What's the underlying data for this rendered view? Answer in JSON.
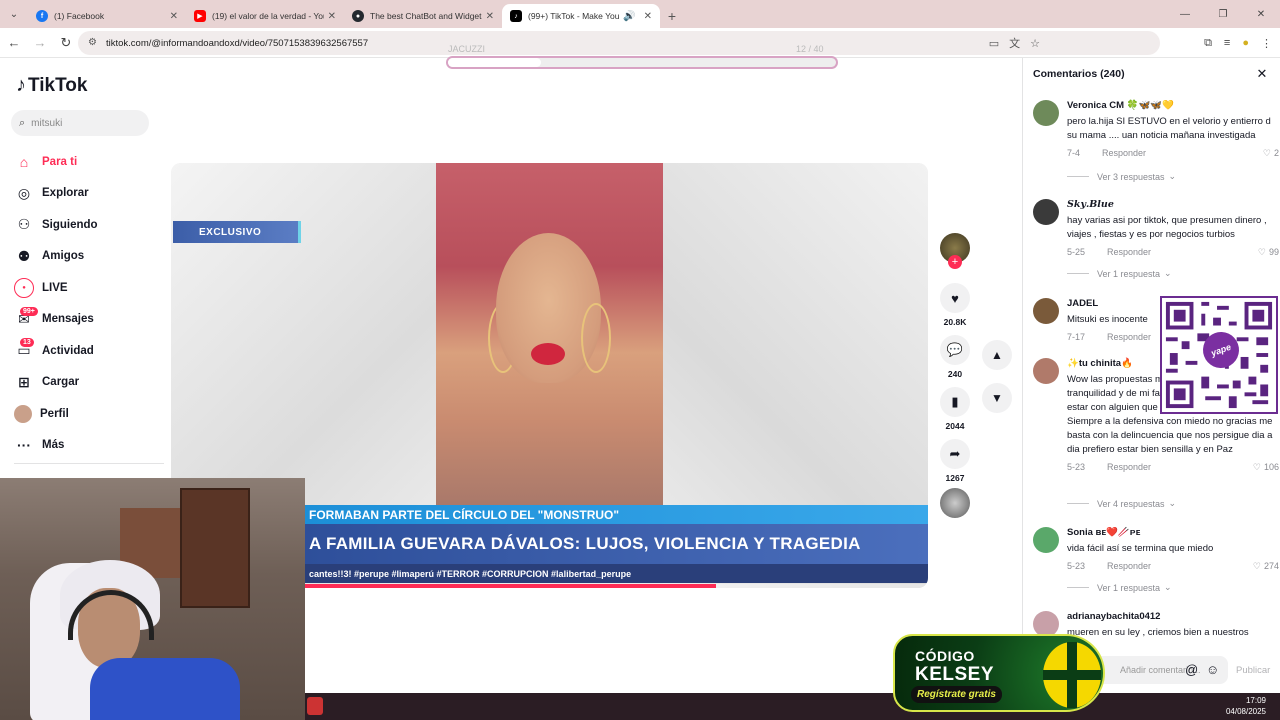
{
  "browser": {
    "tabs": [
      {
        "label": "(1) Facebook",
        "icon": "facebook-icon",
        "color": "#1877f2",
        "glyph": "f"
      },
      {
        "label": "(19) el valor de la verdad - YouTube",
        "icon": "youtube-icon",
        "color": "#ff0000",
        "glyph": "▶"
      },
      {
        "label": "The best ChatBot and Widgets",
        "icon": "github-icon",
        "color": "#24292f",
        "glyph": "●"
      },
      {
        "label": "(99+) TikTok - Make Your Day",
        "icon": "tiktok-icon",
        "color": "#000000",
        "glyph": "♪"
      }
    ],
    "url": "tiktok.com/@informandoandoxd/video/7507153839632567557"
  },
  "overlay": {
    "progress_label_left": "JACUZZI",
    "progress_label_right": "12 / 40",
    "progress": 0.24
  },
  "sidebar": {
    "logo": "TikTok",
    "search_placeholder": "mitsuki",
    "items": [
      {
        "label": "Para ti",
        "icon": "home-icon",
        "glyph": "⌂",
        "active": true
      },
      {
        "label": "Explorar",
        "icon": "compass-icon",
        "glyph": "◎"
      },
      {
        "label": "Siguiendo",
        "icon": "following-icon",
        "glyph": "⚇"
      },
      {
        "label": "Amigos",
        "icon": "friends-icon",
        "glyph": "⚉"
      },
      {
        "label": "LIVE",
        "icon": "live-icon",
        "glyph": "◉"
      },
      {
        "label": "Mensajes",
        "icon": "messages-icon",
        "glyph": "✉",
        "badge": "99+"
      },
      {
        "label": "Actividad",
        "icon": "activity-icon",
        "glyph": "▭",
        "badge": "13"
      },
      {
        "label": "Cargar",
        "icon": "upload-icon",
        "glyph": "⊞"
      },
      {
        "label": "Perfil",
        "icon": "profile-icon",
        "glyph": "●"
      },
      {
        "label": "Más",
        "icon": "more-icon",
        "glyph": "···"
      }
    ]
  },
  "video": {
    "badge": "EXCLUSIVO",
    "ticker_top": "FORMABAN PARTE DEL CÍRCULO DEL \"MONSTRUO\"",
    "headline": "A FAMILIA GUEVARA DÁVALOS: LUJOS, VIOLENCIA Y TRAGEDIA",
    "hashtags": "cantes!!3! #perupe #limaperú #TERROR #CORRUPCION #lalibertad_perupe",
    "progress": 0.72
  },
  "actions": {
    "likes": "20.8K",
    "comments": "240",
    "saves": "2044",
    "shares": "1267"
  },
  "comments_panel": {
    "title": "Comentarios (240)",
    "reply_label": "Responder",
    "items": [
      {
        "user": "Veronica CM 🍀🦋🦋💛",
        "text": "pero la.hija SI ESTUVO en el velorio y entierro d su mama .... uan noticia mañana investigada",
        "date": "7-4",
        "likes": "2",
        "replies": "Ver 3 respuestas",
        "avatar_color": "#6e8a5a"
      },
      {
        "user": "𝑺𝒌𝒚.𝑩𝒍𝒖𝒆",
        "text": "hay varias asi por tiktok, que presumen dinero , viajes , fiestas y es por negocios turbios",
        "date": "5-25",
        "likes": "99",
        "replies": "Ver 1 respuesta",
        "avatar_color": "#3a3a3a"
      },
      {
        "user": "JADEL",
        "text": "Mitsuki es inocente",
        "date": "7-17",
        "likes": "",
        "replies": "",
        "avatar_color": "#7a5a3a"
      },
      {
        "user": "✨tu chinita🔥",
        "text": "Wow las propuestas muy buenas viviendo en tranquilidad y de mi familia y de mi es el precio estar con alguien que te da Ciertos Lujos pero Siempre a la defensiva con miedo no gracias me basta con la delincuencia que nos persigue dia a dia prefiero estar bien sensilla y en Paz",
        "date": "5-23",
        "likes": "106",
        "replies": "Ver 4 respuestas",
        "avatar_color": "#b07a6a"
      },
      {
        "user": "Sonia ʙᴇ❤️🥢ᴘᴇ",
        "text": "vida fácil así se termina que miedo",
        "date": "5-23",
        "likes": "274",
        "replies": "Ver 1 respuesta",
        "avatar_color": "#5aa86a"
      },
      {
        "user": "adrianaybachita0412",
        "text": "mueren en su ley , criemos bien a nuestros",
        "date": "",
        "likes": "",
        "replies": "",
        "avatar_color": "#c8a0a8"
      }
    ],
    "input_placeholder": "Añadir comentario...",
    "publish_label": "Publicar"
  },
  "promo": {
    "line1": "CÓDIGO",
    "line2": "KELSEY",
    "button": "Regístrate gratis"
  },
  "taskbar": {
    "time": "17:09",
    "date": "04/08/2025"
  }
}
